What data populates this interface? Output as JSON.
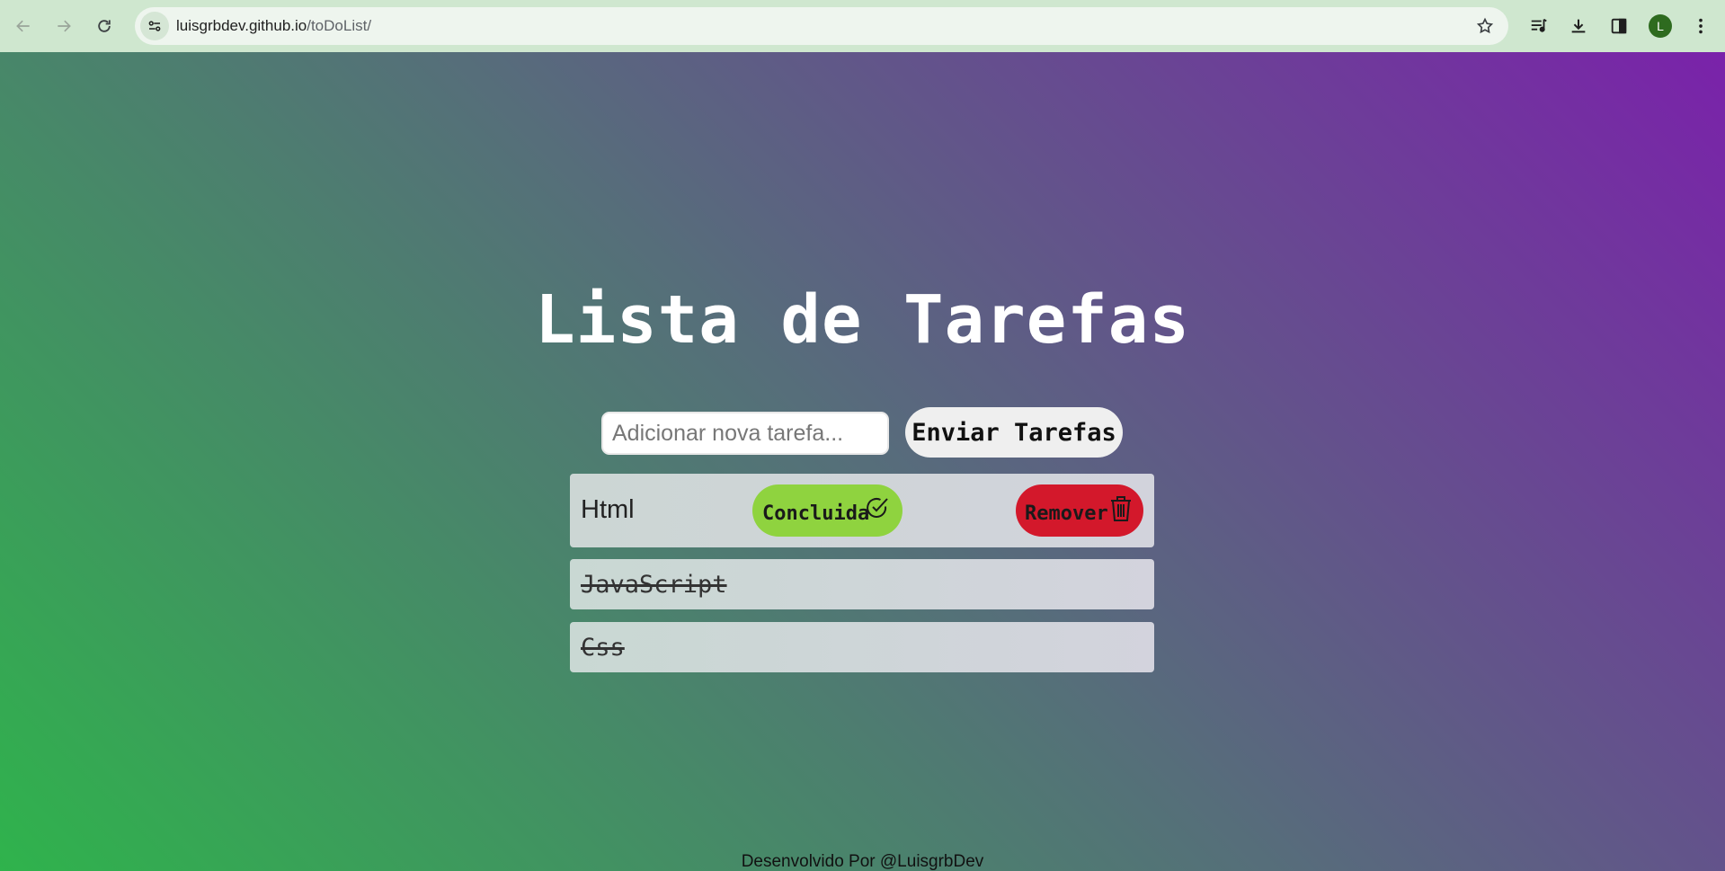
{
  "browser": {
    "url_host": "luisgrbdev.github.io",
    "url_path": "/toDoList/",
    "profile_initial": "L",
    "icons": [
      "back-icon",
      "forward-icon",
      "reload-icon",
      "site-info-icon",
      "star-icon",
      "media-icon",
      "download-icon",
      "side-panel-icon",
      "menu-icon"
    ]
  },
  "page": {
    "title": "Lista de Tarefas",
    "input_placeholder": "Adicionar nova tarefa...",
    "send_label": "Enviar Tarefas",
    "tasks": [
      {
        "name": "Html",
        "done": false,
        "done_label": "Concluida",
        "remove_label": "Remover"
      },
      {
        "name": "JavaScript",
        "done": true
      },
      {
        "name": "Css",
        "done": true
      }
    ],
    "footer": "Desenvolvido Por @LuisgrbDev"
  },
  "colors": {
    "gradient_start": "#2fb34c",
    "gradient_mid": "#566e7a",
    "gradient_end": "#7a22aa",
    "done_button": "#8fd33f",
    "remove_button": "#d3182b"
  }
}
